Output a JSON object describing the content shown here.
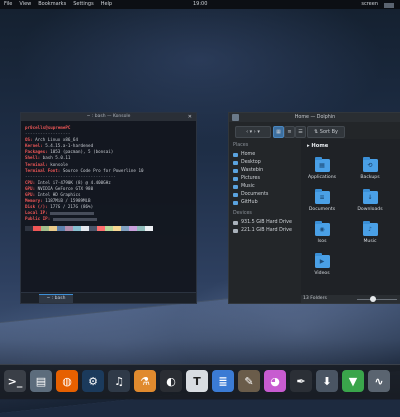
{
  "topbar": {
    "menus": [
      "File",
      "View",
      "Bookmarks",
      "Settings",
      "Help"
    ],
    "clock": "19:00",
    "tray_text": "screen"
  },
  "konsole": {
    "title": "~ : bash — Konsole",
    "tab_label": "~ : bash",
    "prompt": "pr0cells@supremePC",
    "separator": "------------------",
    "info": [
      {
        "key": "OS:",
        "value": "Arch Linux x86_64"
      },
      {
        "key": "Kernel:",
        "value": "5.4.15.a-1-hardened"
      },
      {
        "key": "Packages:",
        "value": "1053 (pacman), 5 (bonsai)"
      },
      {
        "key": "Shell:",
        "value": "bash 5.0.11"
      },
      {
        "key": "Terminal:",
        "value": "konsole"
      },
      {
        "key": "Terminal Font:",
        "value": "Source Code Pro for Powerline 10"
      }
    ],
    "separator2": "------------------------------------",
    "hw": [
      {
        "key": "CPU:",
        "value": "Intel i7-4790K (8) @ 4.400GHz"
      },
      {
        "key": "GPU:",
        "value": "NVIDIA GeForce GTX 980"
      },
      {
        "key": "GPU:",
        "value": "Intel HD Graphics"
      },
      {
        "key": "Memory:",
        "value": "1187MiB / 15989MiB"
      },
      {
        "key": "Disk (/):",
        "value": "177G / 217G (86%)"
      },
      {
        "key": "Local IP:",
        "value": ""
      },
      {
        "key": "Public IP:",
        "value": ""
      }
    ],
    "palette": [
      "#2e3440",
      "#ef5757",
      "#a3be8c",
      "#ebcb8b",
      "#5e81ac",
      "#b48ead",
      "#88c0d0",
      "#e5e9f0",
      "#4c566a",
      "#ff6e6e",
      "#b7d89a",
      "#f7d794",
      "#81a1c1",
      "#c9a0dc",
      "#8fbcbb",
      "#eceff4"
    ]
  },
  "dolphin": {
    "title": "Home — Dolphin",
    "sort_label": "Sort By",
    "places_header": "Places",
    "places": [
      "Home",
      "Desktop",
      "Wastebin",
      "Pictures",
      "Music",
      "Documents",
      "GitHub"
    ],
    "devices_header": "Devices",
    "devices": [
      "931.5 GiB Hard Drive",
      "221.1 GiB Hard Drive"
    ],
    "breadcrumb": "Home",
    "folders": [
      "Applications",
      "Backups",
      "Documents",
      "Downloads",
      "Isos",
      "Music",
      "Videos"
    ],
    "status": "13 Folders",
    "zoom_level": 0.4
  },
  "dock": {
    "icons": [
      {
        "name": "terminal-icon",
        "color": "#3a3f47"
      },
      {
        "name": "file-manager-icon",
        "color": "#5c6c7c"
      },
      {
        "name": "firefox-icon",
        "color": "#e66000"
      },
      {
        "name": "steam-icon",
        "color": "#1b3a5c"
      },
      {
        "name": "headphones-icon",
        "color": "#2f3a48"
      },
      {
        "name": "beaker-icon",
        "color": "#e08a2e"
      },
      {
        "name": "github-icon",
        "color": "#2a2d33"
      },
      {
        "name": "typora-icon",
        "color": "#d9dde2"
      },
      {
        "name": "notes-icon",
        "color": "#3b7bd4"
      },
      {
        "name": "gimp-icon",
        "color": "#6a5c4a"
      },
      {
        "name": "color-picker-icon",
        "color": "#c75bd0"
      },
      {
        "name": "inkscape-icon",
        "color": "#2b2f36"
      },
      {
        "name": "downloader-icon",
        "color": "#4a5563"
      },
      {
        "name": "download-manager-icon",
        "color": "#3aa54b"
      },
      {
        "name": "system-monitor-icon",
        "color": "#5a6470"
      }
    ]
  }
}
